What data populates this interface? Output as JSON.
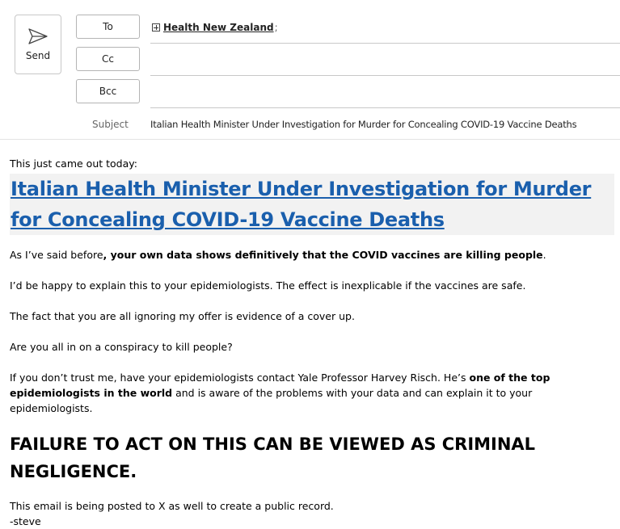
{
  "compose": {
    "send_label": "Send",
    "to_label": "To",
    "cc_label": "Cc",
    "bcc_label": "Bcc",
    "recipient": "Health New Zealand",
    "recipient_separator": ";",
    "subject_label": "Subject",
    "subject": "Italian Health Minister Under Investigation for Murder for Concealing COVID-19 Vaccine Deaths"
  },
  "body": {
    "intro": "This just came out today:",
    "headline": "Italian Health Minister Under Investigation for Murder for Concealing COVID-19 Vaccine Deaths",
    "p1_a": "As I’ve said before",
    "p1_b": ", your own data shows definitively that the COVID vaccines are killing people",
    "p1_c": ".",
    "p2": "I’d be happy to explain this to your epidemiologists. The effect is inexplicable if the vaccines are safe.",
    "p3": "The fact that you are all ignoring my offer is evidence of a cover up.",
    "p4": "Are you all in on a conspiracy to kill people?",
    "p5_a": "If you don’t trust me, have your epidemiologists contact Yale Professor Harvey Risch. He’s ",
    "p5_b": "one of the top epidemiologists in the world",
    "p5_c": " and is aware of the problems with your data and can explain it to your epidemiologists.",
    "warning": "FAILURE TO ACT ON THIS CAN BE VIEWED AS CRIMINAL NEGLIGENCE.",
    "closing": "This email is being posted to X as well to create a public record.",
    "signature": "-steve"
  }
}
